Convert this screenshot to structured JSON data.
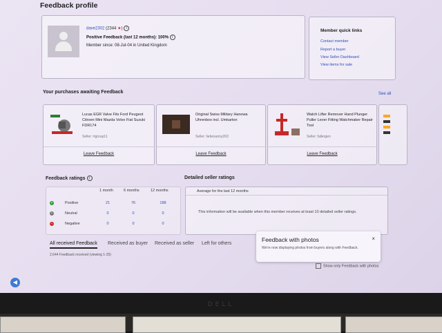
{
  "page": {
    "title": "Feedback profile"
  },
  "profile": {
    "username": "dave2302",
    "score": "(2344",
    "score_close": ")",
    "positive": "Positive Feedback (last 12 months): 100%",
    "member_since": "Member since: 08-Jul-04 in United Kingdom"
  },
  "quick_links": {
    "title": "Member quick links",
    "items": [
      "Contact member",
      "Report a buyer",
      "View Seller Dashboard",
      "View items for sale"
    ]
  },
  "purchases": {
    "title": "Your purchases awaiting Feedback",
    "see_all": "See all",
    "items": [
      {
        "title": "Lucas EGR Valve Fits Ford Peugeot Citroen Mini Mazda Volvo Fiat Suzuki FDR174",
        "seller": "Seller: rtgroup11",
        "action": "Leave Feedback"
      },
      {
        "title": "Original Swiss Military Hanowa Uhrenbox incl. Umkarton",
        "seller": "Seller: liebesunny263",
        "action": "Leave Feedback"
      },
      {
        "title": "Watch Lifter Remover Hand Plunger Puller Lever Fitting Watchmaker Repair Tool",
        "seller": "Seller: fallergen",
        "action": "Leave Feedback"
      }
    ]
  },
  "ratings": {
    "title": "Feedback ratings",
    "columns": [
      "1 month",
      "6 months",
      "12 months"
    ],
    "rows": [
      {
        "label": "Positive",
        "values": [
          "21",
          "76",
          "188"
        ],
        "color": "#2e9b3a"
      },
      {
        "label": "Neutral",
        "values": [
          "0",
          "0",
          "0"
        ],
        "color": "#777777"
      },
      {
        "label": "Negative",
        "values": [
          "0",
          "0",
          "0"
        ],
        "color": "#d22b2b"
      }
    ]
  },
  "dsr": {
    "title": "Detailed seller ratings",
    "header": "Average for the last 12 months",
    "message": "This information will be available when this member receives at least 10 detailed seller ratings."
  },
  "tabs": {
    "items": [
      "All received Feedback",
      "Received as buyer",
      "Received as seller",
      "Left for others"
    ],
    "count": "2,644 Feedback received (viewing 1-25)"
  },
  "popup": {
    "title": "Feedback with photos",
    "body": "We're now displaying photos from buyers along with Feedback.",
    "close": "×"
  },
  "filter": {
    "label": "Show only Feedback with photos"
  },
  "monitor": {
    "brand": "DELL"
  }
}
